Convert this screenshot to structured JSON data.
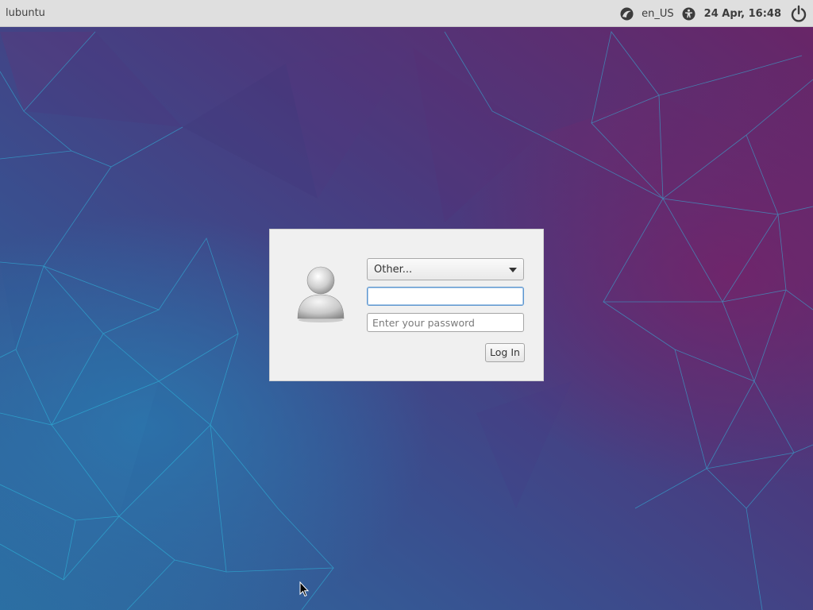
{
  "panel": {
    "hostname": "lubuntu",
    "language": "en_US",
    "clock": "24 Apr, 16:48",
    "icons": {
      "session": "session-icon",
      "accessibility": "accessibility-icon",
      "power": "power-icon"
    }
  },
  "login": {
    "user_select_value": "Other...",
    "username_value": "",
    "password_placeholder": "Enter your password",
    "login_button_label": "Log In",
    "avatar_icon": "user-avatar-icon"
  },
  "colors": {
    "panel_bg": "#dfdfdf",
    "wallpaper_purple": "#5b2a6e",
    "wallpaper_blue": "#2a6a9e",
    "focus_border": "#5d96cf"
  }
}
